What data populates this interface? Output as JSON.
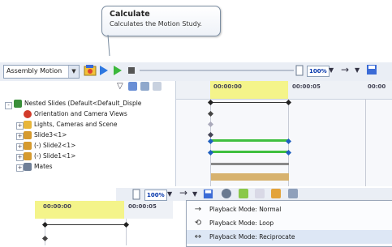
{
  "tooltip": {
    "title": "Calculate",
    "description": "Calculates the Motion Study."
  },
  "toolbar": {
    "study_type": "Assembly Motion",
    "zoom_value": "100%",
    "icons": [
      "calculate-icon",
      "play-icon",
      "play-from-start-icon",
      "stop-icon",
      "playback-speed-icon",
      "playback-mode-icon",
      "save-animation-icon"
    ]
  },
  "tree": {
    "items": [
      {
        "label": "Nested Slides (Default<Default_Disple",
        "icon": "assembly-icon",
        "expander": "-"
      },
      {
        "label": "Orientation and Camera Views",
        "icon": "orientation-icon",
        "expander": ""
      },
      {
        "label": "Lights, Cameras and Scene",
        "icon": "lights-icon",
        "expander": "+"
      },
      {
        "label": "Slide3<1>",
        "icon": "part-icon",
        "expander": "+"
      },
      {
        "label": "(-) Slide2<1>",
        "icon": "part-icon",
        "expander": "+"
      },
      {
        "label": "(-) Slide1<1>",
        "icon": "part-icon",
        "expander": "+"
      },
      {
        "label": "Mates",
        "icon": "mates-icon",
        "expander": "+"
      }
    ]
  },
  "timeline": {
    "time_start": "00:00:00",
    "time_next": "00:00:05",
    "time_next2": "00:00"
  },
  "timeline2": {
    "time_start": "00:00:00",
    "time_next": "00:00:05"
  },
  "toolbar2": {
    "zoom_value": "100%"
  },
  "playback_menu": {
    "items": [
      {
        "label": "Playback Mode: Normal",
        "icon": "playback-normal-icon",
        "glyph": "→"
      },
      {
        "label": "Playback Mode: Loop",
        "icon": "playback-loop-icon",
        "glyph": "⟲"
      },
      {
        "label": "Playback Mode: Reciprocate",
        "icon": "playback-reciprocate-icon",
        "glyph": "↔"
      }
    ]
  },
  "colors": {
    "accent_yellow": "#f4f48a",
    "bar_green": "#3fbf3f",
    "bar_blue": "#1f5fbf",
    "bar_tan": "#d7b26e"
  }
}
